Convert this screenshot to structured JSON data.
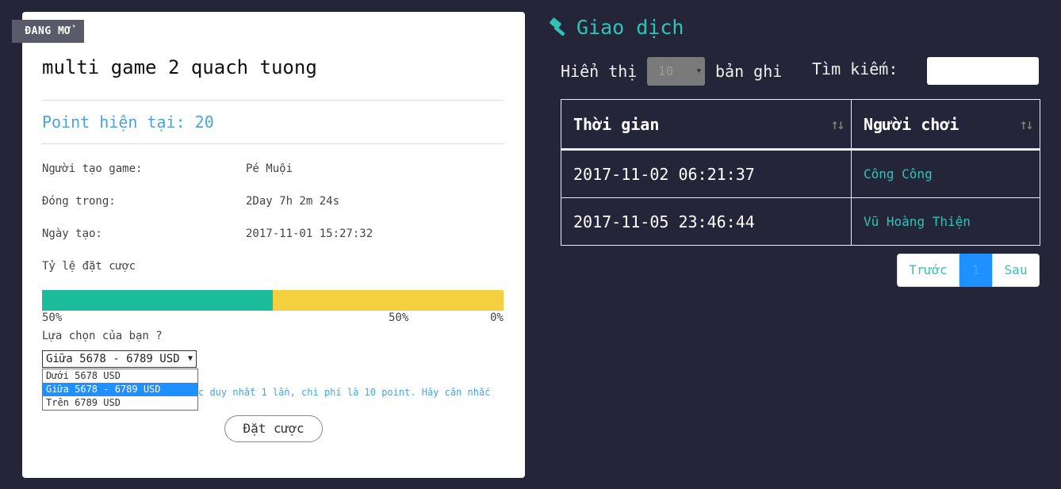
{
  "colors": {
    "background": "#25253a",
    "accent_teal": "#2ec4b6",
    "point_blue": "#4aa3df",
    "bar_left": "#1abc9c",
    "bar_right": "#f4d03f",
    "active_page": "#1e90ff"
  },
  "game": {
    "status_badge": "ĐANG MỞ",
    "title": "multi game 2 quach tuong",
    "point_label": "Point hiện tại: 20",
    "info": {
      "creator_label": "Người tạo game:",
      "creator_value": "Pé Muội",
      "closes_label": "Đóng trong:",
      "closes_value": "2Day 7h 2m 24s",
      "created_label": "Ngày tạo:",
      "created_value": "2017-11-01 15:27:32"
    },
    "bet_ratio_label": "Tỷ lệ đặt cược",
    "bet_ratio": {
      "left_percent": 50,
      "right_percent": 50,
      "left_label": "50%",
      "right_label": "50%",
      "end_label": "0%"
    },
    "choice_question": "Lựa chọn của bạn ?",
    "choice_selected": "Giữa 5678 - 6789 USD",
    "choice_options": [
      "Dưới 5678 USD",
      "Giữa 5678 - 6789 USD",
      "Trên 6789 USD"
    ],
    "note_visible_text": "c duy nhất 1 lần, chi phí là 10 point. Hãy cân nhắc",
    "bet_button": "Đặt cược"
  },
  "transactions": {
    "title": "Giao dịch",
    "title_icon": "gavel-icon",
    "show_label": "Hiển thị",
    "page_length": "10",
    "records_label": "bản ghi",
    "search_label": "Tìm kiếm:",
    "search_value": "",
    "columns": [
      "Thời gian",
      "Người chơi"
    ],
    "rows": [
      {
        "time": "2017-11-02 06:21:37",
        "player": "Công Công"
      },
      {
        "time": "2017-11-05 23:46:44",
        "player": "Vũ Hoàng Thiện"
      }
    ],
    "pagination": {
      "prev": "Trước",
      "current": "1",
      "next": "Sau"
    }
  }
}
